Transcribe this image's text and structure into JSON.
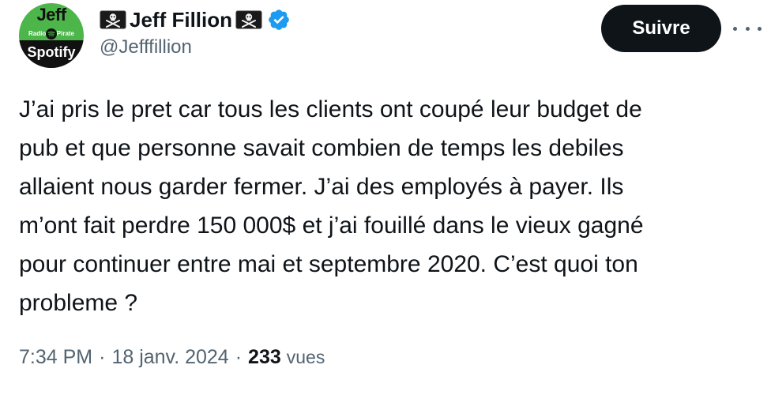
{
  "avatar": {
    "top_text": "Jeff",
    "left_small": "Radio",
    "right_small": "Pirate",
    "bottom_text": "Spotify",
    "icon": "spotify-icon"
  },
  "author": {
    "name": "Jeff Fillion",
    "handle": "@Jefffillion",
    "flag_icon": "jolly-roger-flag-icon",
    "verified_icon": "verified-badge-icon",
    "verified_color": "#1d9bf0"
  },
  "follow_button": {
    "label": "Suivre"
  },
  "more_icon": "more-options-icon",
  "tweet": {
    "lines": [
      "J’ai pris le pret car tous les clients ont coupé leur budget de",
      "pub et que personne savait combien de temps les debiles",
      "allaient nous garder fermer. J’ai des employés à payer. Ils",
      "m’ont fait perdre 150 000$ et  j’ai fouillé dans le vieux gagné",
      "pour continuer entre mai et septembre 2020. C’est quoi ton",
      "probleme ?"
    ]
  },
  "meta": {
    "time": "7:34 PM",
    "separator": "·",
    "date": "18 janv. 2024",
    "views_count": "233",
    "views_label": "vues"
  },
  "colors": {
    "text": "#0f1419",
    "secondary": "#536471",
    "button_bg": "#0f1419",
    "avatar_green": "#4cb64a"
  }
}
